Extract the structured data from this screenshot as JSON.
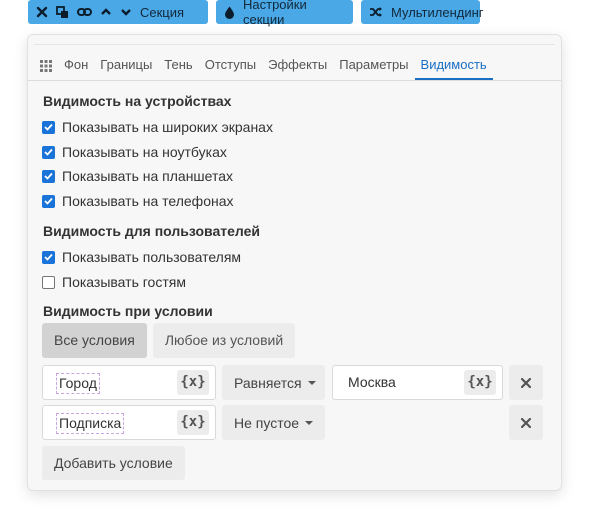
{
  "toolbar": {
    "section_label": "Секция",
    "settings_label": "Настройки секции",
    "multilanding_label": "Мультилендинг"
  },
  "tabs": [
    {
      "label": "Фон"
    },
    {
      "label": "Границы"
    },
    {
      "label": "Тень"
    },
    {
      "label": "Отступы"
    },
    {
      "label": "Эффекты"
    },
    {
      "label": "Параметры"
    },
    {
      "label": "Видимость",
      "active": true
    }
  ],
  "devices": {
    "title": "Видимость на устройствах",
    "items": [
      {
        "label": "Показывать на широких экранах",
        "checked": true
      },
      {
        "label": "Показывать на ноутбуках",
        "checked": true
      },
      {
        "label": "Показывать на планшетах",
        "checked": true
      },
      {
        "label": "Показывать на телефонах",
        "checked": true
      }
    ]
  },
  "users": {
    "title": "Видимость для пользователей",
    "items": [
      {
        "label": "Показывать пользователям",
        "checked": true
      },
      {
        "label": "Показывать гостям",
        "checked": false
      }
    ]
  },
  "condition": {
    "title": "Видимость при условии",
    "modes": [
      {
        "label": "Все условия",
        "active": true
      },
      {
        "label": "Любое из условий",
        "active": false
      }
    ],
    "rows": [
      {
        "field": "Город",
        "var_label": "{x}",
        "operator": "Равняется",
        "value": "Москва"
      },
      {
        "field": "Подписка",
        "var_label": "{x}",
        "operator": "Не пустое"
      }
    ],
    "add_label": "Добавить условие"
  },
  "colors": {
    "toolbar_bg": "#4aa8e6",
    "accent": "#1a6fc4",
    "checkbox": "#1a73d9"
  }
}
